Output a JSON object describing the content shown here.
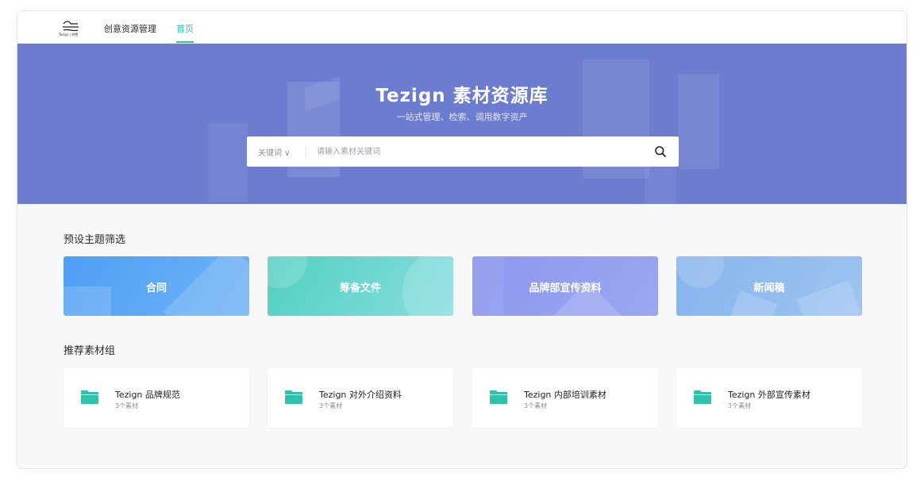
{
  "nav": {
    "logo_text": "Tezign | 特赞",
    "items": [
      {
        "label": "创意资源管理"
      },
      {
        "label": "首页",
        "active": true
      }
    ],
    "active_color": "#2fc2a8"
  },
  "hero": {
    "title": "Tezign 素材资源库",
    "subtitle": "一站式管理、检索、调用数字资产",
    "background": "#6c7dd0",
    "search": {
      "type_label": "关键词 ∨",
      "placeholder": "请输入素材关键词",
      "value": ""
    }
  },
  "themes": {
    "title": "预设主题筛选",
    "items": [
      {
        "label": "合同"
      },
      {
        "label": "筹备文件"
      },
      {
        "label": "品牌部宣传资料"
      },
      {
        "label": "新闻稿"
      }
    ]
  },
  "groups": {
    "title": "推荐素材组",
    "items": [
      {
        "name": "Tezign 品牌规范",
        "count": "3个素材"
      },
      {
        "name": "Tezign 对外介绍资料",
        "count": "3个素材"
      },
      {
        "name": "Tezign 内部培训素材",
        "count": "3个素材"
      },
      {
        "name": "Tezign 外部宣传素材",
        "count": "3个素材"
      }
    ],
    "icon": "folder-icon",
    "icon_color": "#2fc2a8"
  }
}
